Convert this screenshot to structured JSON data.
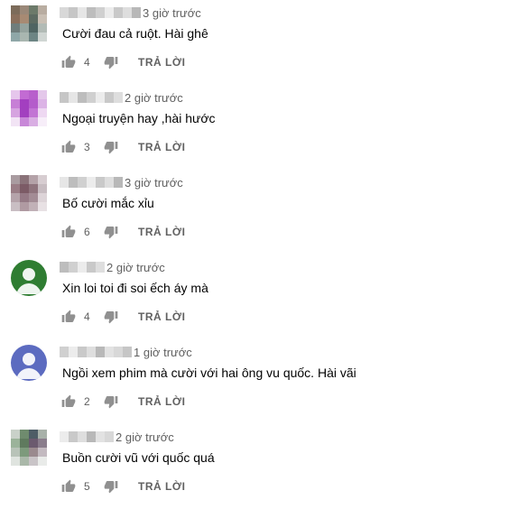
{
  "comments": [
    {
      "time": "3 giờ trước",
      "text": "Cười đau cả ruột. Hài ghê",
      "likes": "4",
      "reply_label": "TRẢ LỜI",
      "avatar_type": "photo",
      "avatar_colors": [
        "#7c6b5a",
        "#9a8878",
        "#6c7a6a",
        "#b9ada1",
        "#8a6f5c",
        "#a78a73",
        "#5d6b62",
        "#c9bfb4",
        "#6f7d7c",
        "#94a39e",
        "#4f6462",
        "#b2bbb6",
        "#8fa7a8",
        "#a9b6b0",
        "#6d8584",
        "#d0d6d3"
      ]
    },
    {
      "time": "2 giờ trước",
      "text": "Ngoại truyện hay ,hài hước",
      "likes": "3",
      "reply_label": "TRẢ LỜI",
      "avatar_type": "photo",
      "avatar_colors": [
        "#e6c6ec",
        "#c26bd3",
        "#b860cc",
        "#e4c8ea",
        "#c77fd6",
        "#a33fc0",
        "#b45ccb",
        "#dcb4e6",
        "#d6a3e0",
        "#a240bf",
        "#c274d4",
        "#eed8f2",
        "#f2e4f5",
        "#c888d8",
        "#d9aee3",
        "#f7eef9"
      ]
    },
    {
      "time": "3 giờ trước",
      "text": "Bố cười mắc xỉu",
      "likes": "6",
      "reply_label": "TRẢ LỜI",
      "avatar_type": "photo",
      "avatar_colors": [
        "#a99ba0",
        "#8a7279",
        "#b4a2a8",
        "#d7cdd1",
        "#9a7d86",
        "#7c5b66",
        "#8f747d",
        "#c7bcc1",
        "#b5a3aa",
        "#957985",
        "#a38c95",
        "#ddd4d8",
        "#c9bec3",
        "#b09aa2",
        "#c1b1b7",
        "#e8e1e4"
      ]
    },
    {
      "time": "2 giờ trước",
      "text": "Xin loi toi đi soi ếch áy mà",
      "likes": "4",
      "reply_label": "TRẢ LỜI",
      "avatar_type": "default",
      "avatar_color": "#2f7d32"
    },
    {
      "time": "1 giờ trước",
      "text": "Ngồi xem phim mà cười với hai ông vu quốc. Hài vãi",
      "likes": "2",
      "reply_label": "TRẢ LỜI",
      "avatar_type": "default",
      "avatar_color": "#5c6bc0"
    },
    {
      "time": "2 giờ trước",
      "text": "Buồn cười vũ với quốc quá",
      "likes": "5",
      "reply_label": "TRẢ LỜI",
      "avatar_type": "photo",
      "avatar_colors": [
        "#c9d1c9",
        "#6f8b6e",
        "#4e5d66",
        "#a8b1a9",
        "#9bb39a",
        "#5f7a5e",
        "#6b5a6e",
        "#8a7d8c",
        "#b8c3b8",
        "#7d9a7c",
        "#9a8a8e",
        "#c3bac0",
        "#dfe4df",
        "#aab8a9",
        "#c9c4c7",
        "#e9ebe9"
      ]
    }
  ],
  "colors": {
    "text": "#030303",
    "secondary": "#606060",
    "icon": "#909090"
  }
}
